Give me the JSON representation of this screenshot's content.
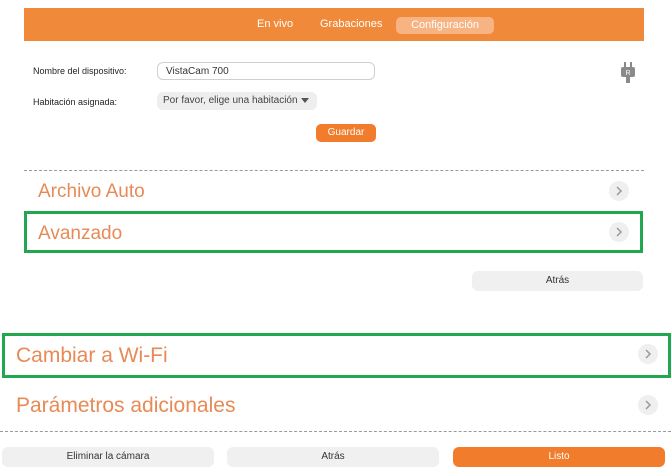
{
  "nav": {
    "tabs": [
      {
        "label": "En vivo"
      },
      {
        "label": "Grabaciones"
      },
      {
        "label": "Configuración",
        "active": true
      }
    ]
  },
  "device_form": {
    "name_label": "Nombre del dispositivo:",
    "name_value": "VistaCam 700",
    "room_label": "Habitación asignada:",
    "room_selected": "Por favor, elige una habitación",
    "save_label": "Guardar"
  },
  "menu": {
    "archivo_auto": "Archivo Auto",
    "avanzado": "Avanzado",
    "back_label": "Atrás"
  },
  "lower_menu": {
    "wifi": "Cambiar a Wi-Fi",
    "extra_params": "Parámetros adicionales"
  },
  "footer": {
    "delete_label": "Eliminar la cámara",
    "back_label": "Atrás",
    "done_label": "Listo"
  },
  "colors": {
    "brand_orange": "#f08a3a",
    "highlight_green": "#22a64f",
    "row_text": "#e78a56"
  },
  "icons": {
    "plug": "plug-icon",
    "chevron": "chevron-right-icon",
    "caret": "caret-down-icon"
  }
}
